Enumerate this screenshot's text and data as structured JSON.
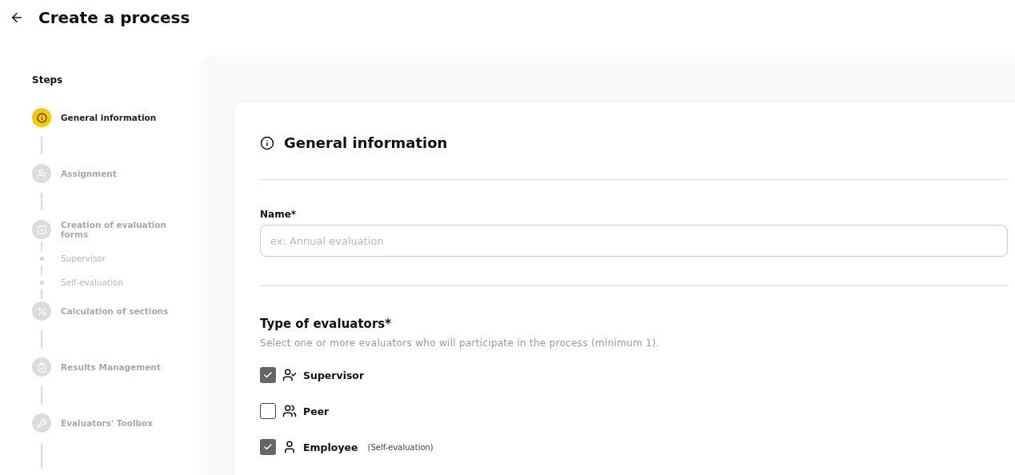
{
  "header": {
    "title": "Create a process"
  },
  "steps": {
    "title": "Steps",
    "items": [
      {
        "kind": "step",
        "label": "General information",
        "selected": true
      },
      {
        "kind": "step",
        "label": "Assignment",
        "selected": false
      },
      {
        "kind": "step",
        "label": "Creation of evaluation forms",
        "selected": false
      },
      {
        "kind": "substep",
        "label": "Supervisor",
        "selected": false
      },
      {
        "kind": "substep",
        "label": "Self-evaluation",
        "selected": false
      },
      {
        "kind": "step",
        "label": "Calculation of sections",
        "selected": false
      },
      {
        "kind": "step",
        "label": "Results Management",
        "selected": false
      },
      {
        "kind": "step",
        "label": "Evaluators' Toolbox",
        "selected": false
      }
    ]
  },
  "form": {
    "section_title": "General information",
    "name_field": {
      "label": "Name*",
      "placeholder": "ex: Annual evaluation"
    },
    "evaluators": {
      "title": "Type of evaluators*",
      "hint": "Select one or more evaluators who will participate in the process (minimum 1).",
      "options": [
        {
          "label": "Supervisor",
          "checked": true
        },
        {
          "label": "Peer",
          "checked": false
        },
        {
          "label": "Employee",
          "note": "(Self-evaluation)",
          "checked": true
        }
      ]
    }
  }
}
